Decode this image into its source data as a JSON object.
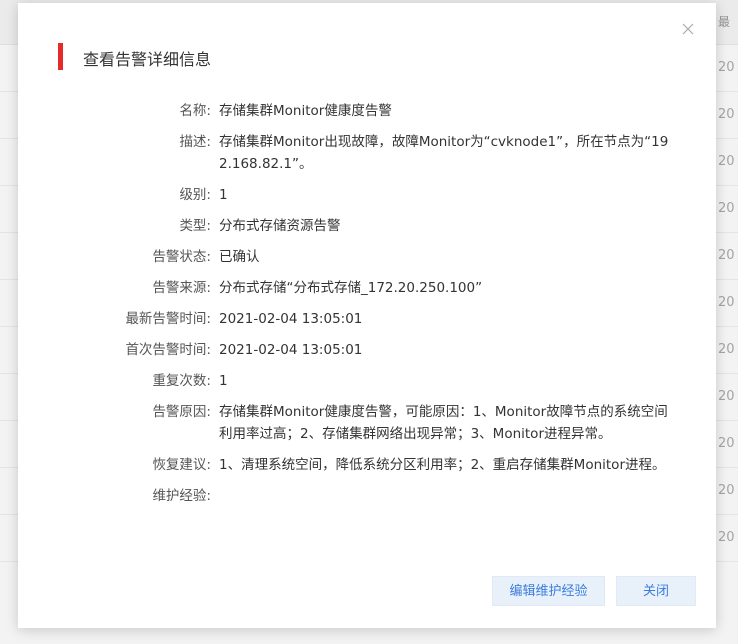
{
  "background": {
    "header_cell": "最",
    "row_cells": [
      "20",
      "20",
      "20",
      "20",
      "20",
      "20",
      "20",
      "20",
      "20",
      "20",
      "20"
    ]
  },
  "modal": {
    "title": "查看告警详细信息",
    "close_icon": "close-icon",
    "accent_color": "#e52a2a",
    "fields": [
      {
        "label": "名称:",
        "value": "存储集群Monitor健康度告警"
      },
      {
        "label": "描述:",
        "value": "存储集群Monitor出现故障，故障Monitor为“cvknode1”，所在节点为“192.168.82.1”。"
      },
      {
        "label": "级别:",
        "value": "1"
      },
      {
        "label": "类型:",
        "value": "分布式存储资源告警"
      },
      {
        "label": "告警状态:",
        "value": "已确认"
      },
      {
        "label": "告警来源:",
        "value": "分布式存储“分布式存储_172.20.250.100”"
      },
      {
        "label": "最新告警时间:",
        "value": "2021-02-04 13:05:01"
      },
      {
        "label": "首次告警时间:",
        "value": "2021-02-04 13:05:01"
      },
      {
        "label": "重复次数:",
        "value": "1"
      },
      {
        "label": "告警原因:",
        "value": "存储集群Monitor健康度告警，可能原因：1、Monitor故障节点的系统空间利用率过高；2、存储集群网络出现异常；3、Monitor进程异常。"
      },
      {
        "label": "恢复建议:",
        "value": "1、清理系统空间，降低系统分区利用率；2、重启存储集群Monitor进程。"
      },
      {
        "label": "维护经验:",
        "value": ""
      }
    ],
    "buttons": {
      "edit_label": "编辑维护经验",
      "close_label": "关闭"
    }
  }
}
